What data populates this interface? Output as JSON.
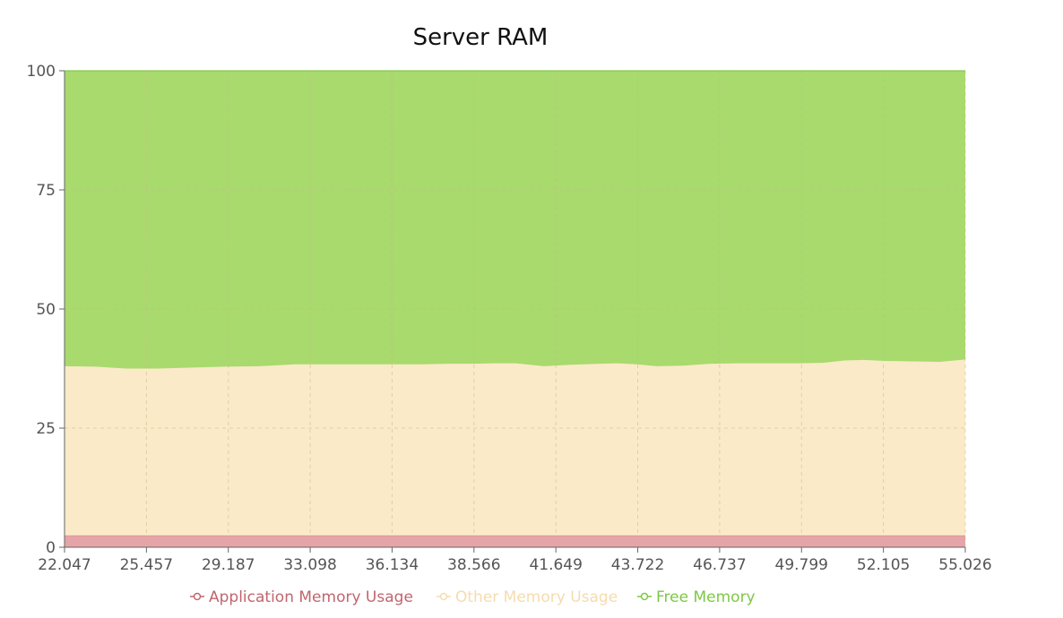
{
  "chart_data": {
    "type": "area",
    "stacked": true,
    "title": "Server RAM",
    "xlabel": "",
    "ylabel": "",
    "ylim": [
      0,
      100
    ],
    "yticks": [
      0,
      25,
      50,
      75,
      100
    ],
    "xlim": [
      22.047,
      55.026
    ],
    "x_tick_labels": [
      "22.047",
      "25.457",
      "29.187",
      "33.098",
      "36.134",
      "38.566",
      "41.649",
      "43.722",
      "46.737",
      "49.799",
      "52.105",
      "55.026"
    ],
    "grid": true,
    "legend_position": "bottom",
    "x": [
      22.047,
      23.2,
      24.3,
      25.457,
      26.6,
      27.9,
      29.187,
      30.5,
      31.8,
      33.098,
      34.1,
      35.1,
      36.134,
      37.0,
      37.8,
      38.566,
      39.6,
      40.6,
      41.649,
      42.3,
      43.0,
      43.722,
      44.7,
      45.7,
      46.737,
      47.8,
      48.8,
      49.799,
      50.6,
      51.3,
      52.105,
      53.1,
      54.1,
      55.026
    ],
    "series": [
      {
        "name": "Application Memory Usage",
        "color": "#c0666e",
        "fill": "#e5a4a8",
        "values": [
          2.5,
          2.5,
          2.5,
          2.5,
          2.5,
          2.5,
          2.5,
          2.5,
          2.5,
          2.5,
          2.5,
          2.5,
          2.5,
          2.5,
          2.5,
          2.5,
          2.5,
          2.5,
          2.5,
          2.5,
          2.5,
          2.5,
          2.5,
          2.5,
          2.5,
          2.5,
          2.5,
          2.5,
          2.5,
          2.5,
          2.5,
          2.5,
          2.5,
          2.5
        ]
      },
      {
        "name": "Other Memory Usage",
        "color": "#fbe7c6",
        "fill": "#fbeac8",
        "values": [
          35.5,
          35.4,
          35.0,
          35.0,
          35.2,
          35.4,
          35.5,
          35.9,
          35.9,
          35.9,
          35.9,
          35.9,
          36.0,
          36.0,
          36.1,
          36.1,
          35.5,
          35.8,
          36.0,
          36.1,
          35.9,
          35.5,
          35.6,
          36.0,
          36.1,
          36.1,
          36.1,
          36.2,
          36.7,
          36.8,
          36.6,
          36.5,
          36.4,
          36.9
        ]
      },
      {
        "name": "Free Memory",
        "color": "#7ec845",
        "fill": "#a8da6e",
        "values": [
          62.0,
          62.1,
          62.5,
          62.5,
          62.3,
          62.1,
          62.0,
          61.6,
          61.6,
          61.6,
          61.6,
          61.6,
          61.5,
          61.5,
          61.4,
          61.4,
          62.0,
          61.7,
          61.5,
          61.4,
          61.6,
          62.0,
          61.9,
          61.5,
          61.4,
          61.4,
          61.4,
          61.3,
          60.8,
          60.7,
          60.9,
          61.0,
          61.1,
          60.6
        ]
      }
    ]
  }
}
